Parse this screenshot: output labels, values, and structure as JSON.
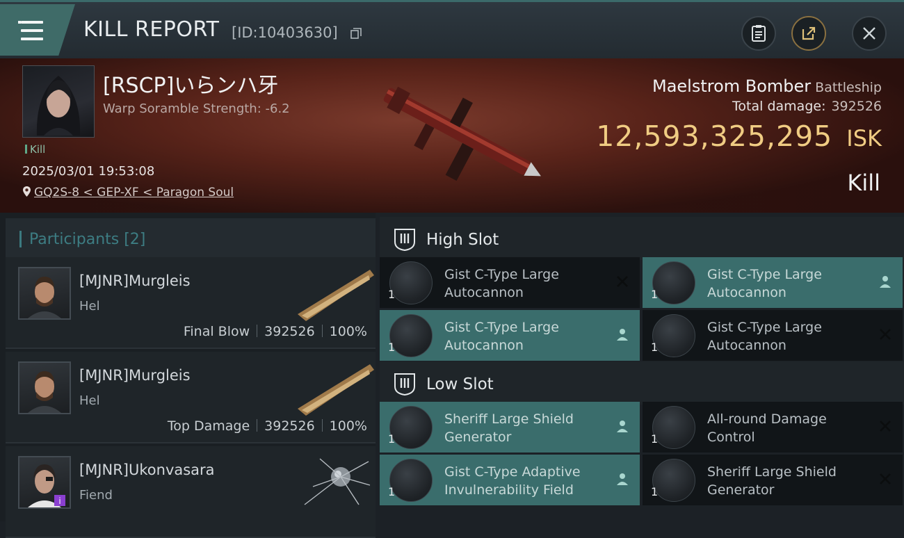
{
  "header": {
    "title": "KILL REPORT",
    "report_id": "[ID:10403630]",
    "icons": [
      "menu-icon",
      "copy-icon",
      "clipboard-icon",
      "share-icon",
      "close-icon"
    ]
  },
  "victim": {
    "name": "[RSCP]いらンハ牙",
    "scramble": "Warp Soramble Strength: -6.2",
    "tag": "Kill",
    "time": "2025/03/01 19:53:08",
    "location": "GQ2S-8 < GEP-XF < Paragon Soul",
    "ship_name": "Maelstrom Bomber",
    "ship_class": "Battleship",
    "damage_label": "Total damage:",
    "damage_value": "392526",
    "isk_value": "12,593,325,295",
    "isk_unit": "ISK",
    "result": "Kill"
  },
  "participants": {
    "title": "Participants [2]",
    "items": [
      {
        "name": "[MJNR]Murgleis",
        "ship": "Hel",
        "role": "Final Blow",
        "damage": "392526",
        "percent": "100%"
      },
      {
        "name": "[MJNR]Murgleis",
        "ship": "Hel",
        "role": "Top Damage",
        "damage": "392526",
        "percent": "100%"
      },
      {
        "name": "[MJNR]Ukonvasara",
        "ship": "Fiend"
      }
    ]
  },
  "fitting": {
    "high_slot": {
      "title": "High Slot",
      "modules": [
        {
          "qty": "1",
          "name": "Gist C-Type Large Autocannon",
          "status": "destroyed"
        },
        {
          "qty": "1",
          "name": "Gist C-Type Large Autocannon",
          "status": "dropped"
        },
        {
          "qty": "1",
          "name": "Gist C-Type Large Autocannon",
          "status": "dropped"
        },
        {
          "qty": "1",
          "name": "Gist C-Type Large Autocannon",
          "status": "destroyed"
        }
      ]
    },
    "low_slot": {
      "title": "Low Slot",
      "modules": [
        {
          "qty": "1",
          "name": "Sheriff Large Shield Generator",
          "status": "dropped"
        },
        {
          "qty": "1",
          "name": "All-round Damage Control",
          "status": "destroyed"
        },
        {
          "qty": "1",
          "name": "Gist C-Type Adaptive Invulnerability Field",
          "status": "dropped"
        },
        {
          "qty": "1",
          "name": "Sheriff Large Shield Generator",
          "status": "destroyed"
        }
      ]
    }
  },
  "colors": {
    "accent_teal": "#3a6d6c",
    "isk_gold": "#f0cc83",
    "participants_title": "#3d7d83"
  }
}
